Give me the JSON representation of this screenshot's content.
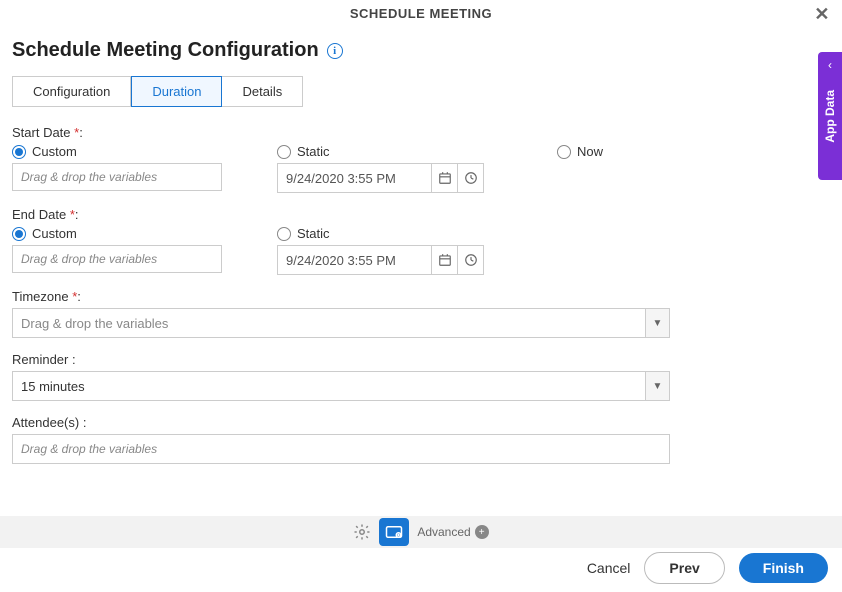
{
  "header": {
    "title": "SCHEDULE MEETING"
  },
  "page": {
    "title": "Schedule Meeting Configuration"
  },
  "tabs": {
    "t1": "Configuration",
    "t2": "Duration",
    "t3": "Details"
  },
  "start": {
    "label": "Start Date ",
    "custom": "Custom",
    "static": "Static",
    "now": "Now",
    "placeholder": "Drag & drop the variables",
    "date": "9/24/2020 3:55 PM"
  },
  "end": {
    "label": "End Date ",
    "custom": "Custom",
    "static": "Static",
    "placeholder": "Drag & drop the variables",
    "date": "9/24/2020 3:55 PM"
  },
  "timezone": {
    "label": "Timezone ",
    "placeholder": "Drag & drop the variables"
  },
  "reminder": {
    "label": "Reminder :",
    "value": "15 minutes"
  },
  "attendees": {
    "label": "Attendee(s) :",
    "placeholder": "Drag & drop the variables"
  },
  "bottom": {
    "advanced": "Advanced"
  },
  "buttons": {
    "cancel": "Cancel",
    "prev": "Prev",
    "finish": "Finish"
  },
  "side": {
    "label": "App Data"
  },
  "req": "*",
  "colon": ":"
}
